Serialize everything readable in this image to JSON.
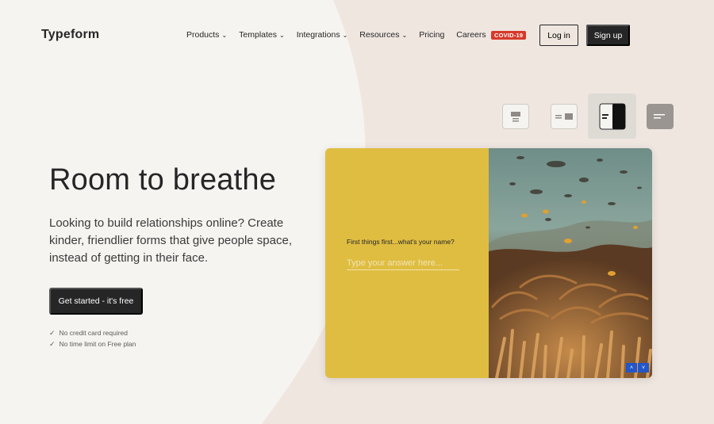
{
  "header": {
    "logo": "Typeform",
    "nav": [
      {
        "label": "Products",
        "has_dropdown": true
      },
      {
        "label": "Templates",
        "has_dropdown": true
      },
      {
        "label": "Integrations",
        "has_dropdown": true
      },
      {
        "label": "Resources",
        "has_dropdown": true
      },
      {
        "label": "Pricing",
        "has_dropdown": false
      },
      {
        "label": "Careers",
        "has_dropdown": false
      }
    ],
    "badge": "COVID-19",
    "login_label": "Log in",
    "signup_label": "Sign up"
  },
  "layout_switcher": {
    "options": [
      "layout-image-top-icon",
      "layout-image-right-icon",
      "layout-split-selected-icon",
      "layout-fullscreen-icon"
    ],
    "selected_index": 2
  },
  "hero": {
    "title": "Room to breathe",
    "subtitle": "Looking to build relationships online? Create kinder, friendlier forms that give people space, instead of getting in their face.",
    "cta_label": "Get started - it's free",
    "checks": [
      "No credit card required",
      "No time limit on Free plan"
    ]
  },
  "preview": {
    "question": "First things first...what's your name?",
    "answer_placeholder": "Type your answer here...",
    "up_arrow": "˄",
    "down_arrow": "˅"
  },
  "colors": {
    "background": "#f6f4f0",
    "blob": "#efe6e0",
    "form_yellow": "#dfbd41",
    "dark": "#262627",
    "covid_red": "#d6392a",
    "arrow_blue": "#2356c9"
  }
}
